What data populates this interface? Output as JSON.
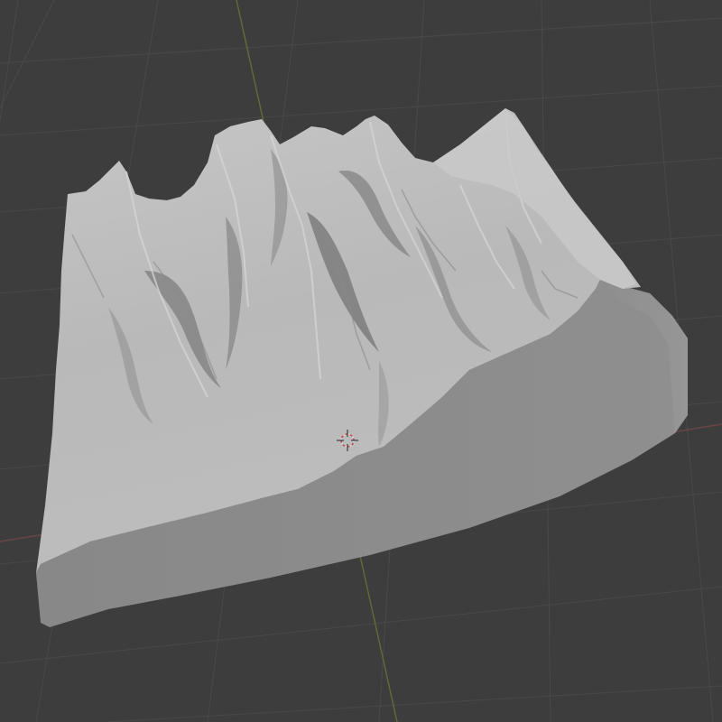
{
  "viewport": {
    "editor": "3D Viewport",
    "object": "terrain-mesh",
    "shading": "solid",
    "colors": {
      "background": "#3d3d3d",
      "grid_line": "#4a4a4a",
      "x_axis": "#7a4a4a",
      "y_axis": "#6b7a3c",
      "mesh_top": "#bdbdbd",
      "mesh_side_front": "#8c8c8c",
      "mesh_side_right": "#919191",
      "shadow": "#6e6e6e"
    }
  },
  "icons": {
    "cursor": "3d-cursor-icon"
  }
}
